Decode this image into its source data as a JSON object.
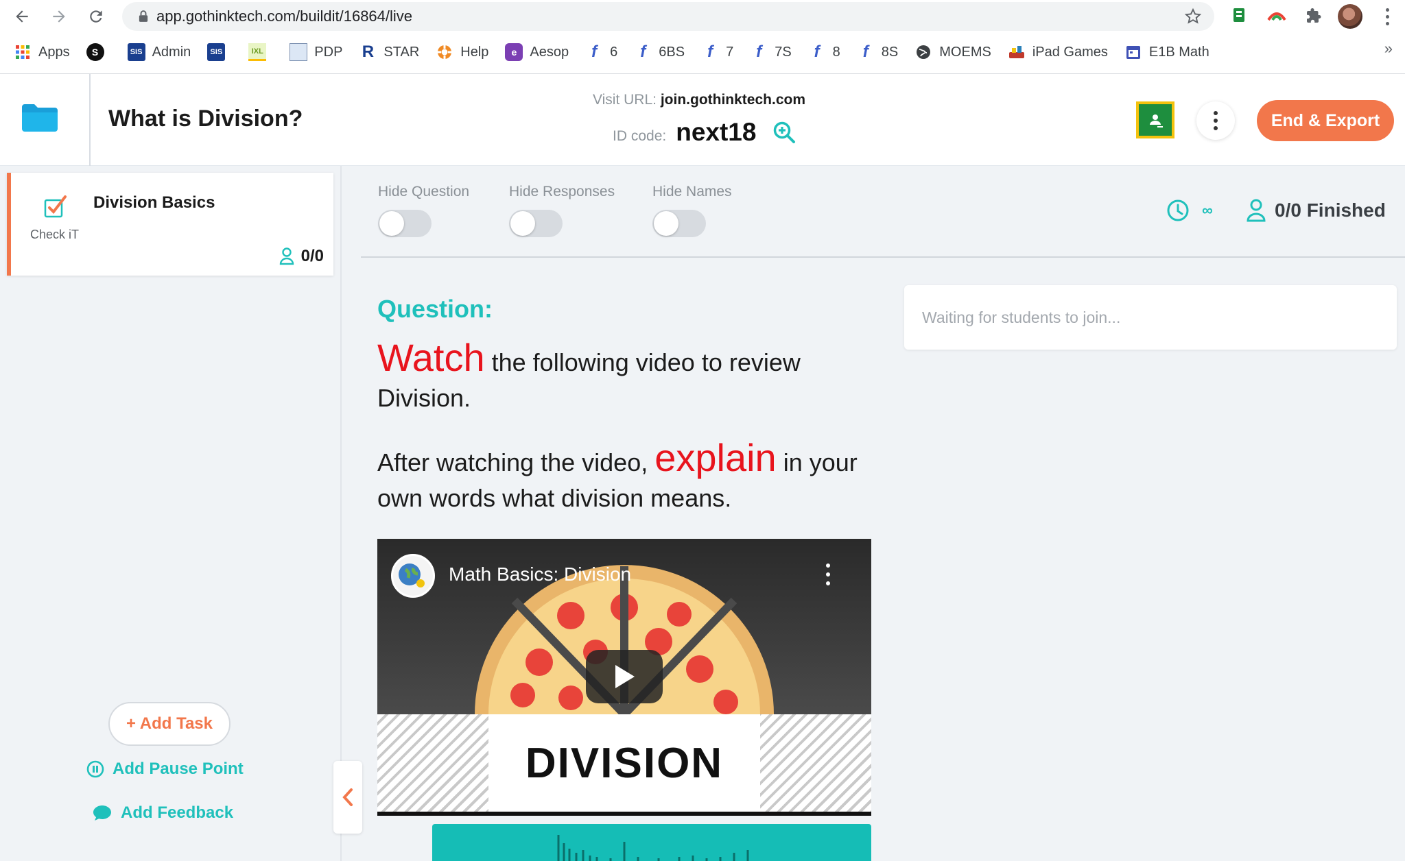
{
  "browser": {
    "url": "app.gothinktech.com/buildit/16864/live",
    "bookmarks": [
      {
        "label": "Apps",
        "icon": "apps-grid-icon"
      },
      {
        "label": "",
        "icon": "s-circle-icon"
      },
      {
        "label": "Admin",
        "icon": "sis-icon"
      },
      {
        "label": "",
        "icon": "sis-icon"
      },
      {
        "label": "",
        "icon": "ixl-icon"
      },
      {
        "label": "PDP",
        "icon": "pdp-icon"
      },
      {
        "label": "STAR",
        "icon": "renaissance-icon"
      },
      {
        "label": "Help",
        "icon": "lifebuoy-icon"
      },
      {
        "label": "Aesop",
        "icon": "aesop-icon"
      },
      {
        "label": "6",
        "icon": "f-icon"
      },
      {
        "label": "6BS",
        "icon": "f-icon"
      },
      {
        "label": "7",
        "icon": "f-icon"
      },
      {
        "label": "7S",
        "icon": "f-icon"
      },
      {
        "label": "8",
        "icon": "f-icon"
      },
      {
        "label": "8S",
        "icon": "f-icon"
      },
      {
        "label": "MOEMS",
        "icon": "globe-icon"
      },
      {
        "label": "iPad Games",
        "icon": "games-icon"
      },
      {
        "label": "E1B Math",
        "icon": "calendar-icon"
      }
    ],
    "more": "»"
  },
  "header": {
    "title": "What is Division?",
    "visit_label": "Visit URL:",
    "visit_url": "join.gothinktech.com",
    "id_label": "ID code:",
    "id_code": "next18",
    "end_button": "End & Export"
  },
  "sidebar": {
    "task": {
      "name": "Division Basics",
      "type": "Check iT",
      "count": "0/0"
    },
    "add_task": "+ Add Task",
    "add_pause": "Add Pause Point",
    "add_feedback": "Add Feedback"
  },
  "controls": {
    "hide_question": "Hide Question",
    "hide_responses": "Hide Responses",
    "hide_names": "Hide Names",
    "timer": "∞",
    "finished": "0/0 Finished"
  },
  "question": {
    "label": "Question:",
    "line1_emph": "Watch",
    "line1_rest": " the following video to review Division.",
    "line2_start": "After watching the video, ",
    "line2_emph": "explain",
    "line2_rest": " in your own words what division means."
  },
  "video": {
    "title": "Math Basics: Division",
    "banner": "DIVISION"
  },
  "responses": {
    "waiting": "Waiting for students to join..."
  },
  "colors": {
    "accent_orange": "#f2774b",
    "accent_teal": "#1fc0bb",
    "emphasis_red": "#e8141d"
  }
}
